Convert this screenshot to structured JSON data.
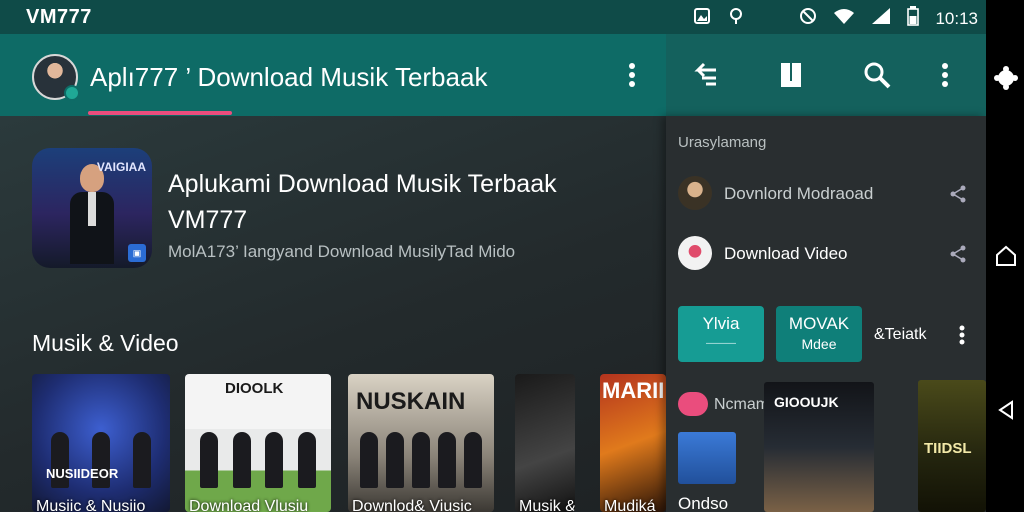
{
  "status_bar": {
    "carrier": "VM777",
    "time": "10:13",
    "icons": [
      "gallery-icon",
      "location-icon",
      "dnd-icon",
      "wifi-icon",
      "signal-icon",
      "battery-icon"
    ]
  },
  "app_bar": {
    "title": "Aplı777 ’ Download Musik Terbaak",
    "icons": [
      "avatar",
      "more-vert-icon"
    ]
  },
  "right_toolbar": {
    "icons": [
      "back-arrow-icon",
      "bookmark-icon",
      "search-icon",
      "more-vert-icon"
    ]
  },
  "hero": {
    "headline_line1": "Aplukami Download Musik Terbaak",
    "headline_line2": "VM777",
    "subtitle": "MolА173’ Iangyand Download MusilyTad Mido",
    "cover_text": "VAIGIAA"
  },
  "section": {
    "title": "Musik & Video"
  },
  "thumbnails": [
    {
      "caption": "Musiic & Nusiio",
      "label": "NUSIIDEOR"
    },
    {
      "caption": "Download Vlusiu",
      "label": "DIOOLK"
    },
    {
      "caption": "Downlod& Viusic",
      "label": "NUSKAIN"
    },
    {
      "caption": "Musik &",
      "label": ""
    },
    {
      "caption": "Mudiká",
      "label": "MARII"
    }
  ],
  "right_panel": {
    "header": "Urasylamang",
    "items": [
      {
        "label": "Dovnlord Modraoad"
      },
      {
        "label": "Download Video"
      }
    ],
    "buttons": [
      {
        "line1": "Ylvia",
        "line2": "———"
      },
      {
        "line1": "MOVAK",
        "line2": "Mdee"
      }
    ],
    "link": "&Teiatk",
    "sub_item": "Ncmamnn",
    "avatar_caption": "Ondso",
    "card_label": "GIOOUJK",
    "card2_label": "TIIDSL"
  },
  "colors": {
    "appbar": "#0e6b66",
    "status_bar": "#0f4b48",
    "accent": "#ea4d7d",
    "teal_button": "#169c94"
  }
}
